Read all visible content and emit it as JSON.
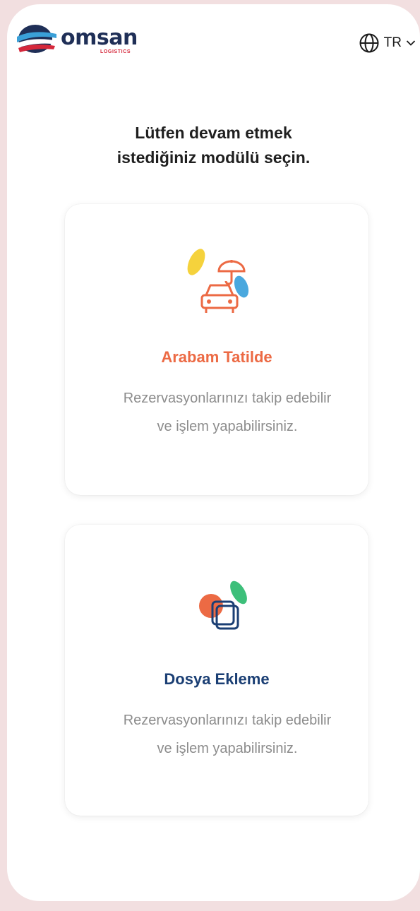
{
  "brand": {
    "name": "omsan",
    "subtitle": "LOGISTICS"
  },
  "language": {
    "current": "TR",
    "icon": "globe-icon"
  },
  "prompt": {
    "line1": "Lütfen devam etmek",
    "line2": "istediğiniz modülü seçin."
  },
  "modules": [
    {
      "title": "Arabam Tatilde",
      "desc_line1": "Rezervasyonlarınızı takip edebilir",
      "desc_line2": "ve işlem yapabilirsiniz.",
      "icon": "car-umbrella-icon",
      "color": "#ec6a44"
    },
    {
      "title": "Dosya Ekleme",
      "desc_line1": "Rezervasyonlarınızı takip edebilir",
      "desc_line2": "ve işlem yapabilirsiniz.",
      "icon": "document-stack-icon",
      "color": "#1b3f74"
    }
  ]
}
